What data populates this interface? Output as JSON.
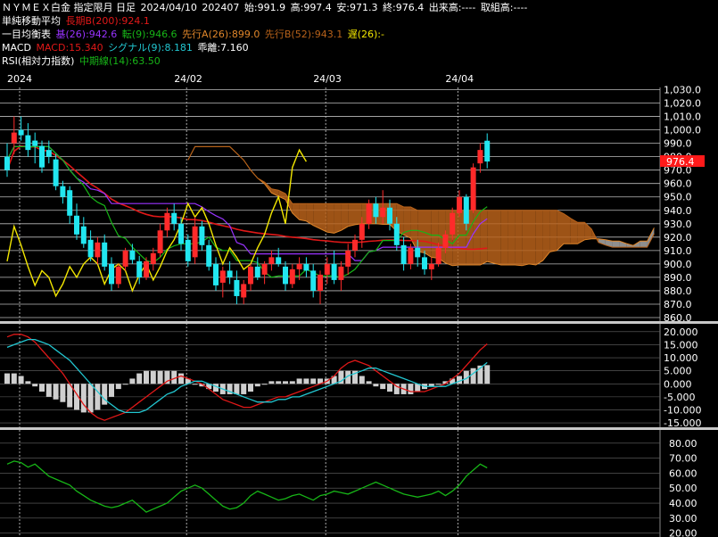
{
  "header": {
    "line1": {
      "title": "ＮＹＭＥＸ白金 指定限月 日足",
      "date": "2024/04/10",
      "contract": "202407",
      "open": "始:991.9",
      "high": "高:997.4",
      "low": "安:971.3",
      "close": "終:976.4",
      "volume": "出来高:----",
      "oi": "取組高:----"
    },
    "line2": {
      "label": "単純移動平均",
      "ma": "長期B(200):924.1"
    },
    "line3": {
      "label": "一目均衡表",
      "kijun": "基(26):942.6",
      "tenkan": "転(9):946.6",
      "spanA": "先行A(26):899.0",
      "spanB": "先行B(52):943.1",
      "chikou": "遅(26):-"
    },
    "line4": {
      "label": "MACD",
      "macd": "MACD:15.340",
      "signal": "シグナル(9):8.181",
      "hist": "乖離:7.160"
    },
    "line5": {
      "label": "RSI(相対力指数)",
      "rsi": "中期線(14):63.50"
    }
  },
  "colors": {
    "up": "#ff2a2a",
    "down": "#22e6f0",
    "ma200": "#e01818",
    "kijun": "#9933ff",
    "tenkan": "#17b517",
    "chikou": "#f2e600",
    "cloud_bull": "#b8621a",
    "cloud_bear": "#a8a8a8",
    "price_tag": "#ff1a1a"
  },
  "chart_data": [
    {
      "type": "candlestick",
      "x_labels": [
        "2024",
        "24/02",
        "24/03",
        "24/04"
      ],
      "y_ticks": [
        "1,030.0",
        "1,020.0",
        "1,010.0",
        "1,000.0",
        "990.0",
        "980.0",
        "970.0",
        "960.0",
        "950.0",
        "940.0",
        "930.0",
        "920.0",
        "910.0",
        "900.0",
        "890.0",
        "880.0",
        "870.0",
        "860.0"
      ],
      "ylim": [
        858,
        1031
      ],
      "last_price_label": "976.4",
      "candles": [
        [
          980,
          990,
          965,
          970
        ],
        [
          990,
          1010,
          982,
          998
        ],
        [
          1000,
          1010,
          992,
          996
        ],
        [
          996,
          1005,
          980,
          985
        ],
        [
          992,
          998,
          975,
          988
        ],
        [
          988,
          992,
          968,
          972
        ],
        [
          985,
          992,
          975,
          980
        ],
        [
          978,
          982,
          955,
          958
        ],
        [
          958,
          962,
          945,
          950
        ],
        [
          955,
          958,
          930,
          936
        ],
        [
          936,
          945,
          918,
          922
        ],
        [
          928,
          935,
          912,
          915
        ],
        [
          918,
          925,
          902,
          905
        ],
        [
          905,
          920,
          900,
          916
        ],
        [
          916,
          922,
          895,
          898
        ],
        [
          900,
          905,
          880,
          885
        ],
        [
          885,
          900,
          882,
          898
        ],
        [
          898,
          912,
          895,
          910
        ],
        [
          910,
          915,
          900,
          903
        ],
        [
          902,
          906,
          885,
          890
        ],
        [
          890,
          905,
          888,
          902
        ],
        [
          900,
          912,
          895,
          908
        ],
        [
          908,
          930,
          905,
          925
        ],
        [
          925,
          942,
          920,
          938
        ],
        [
          938,
          945,
          925,
          930
        ],
        [
          930,
          935,
          910,
          915
        ],
        [
          918,
          922,
          898,
          902
        ],
        [
          905,
          935,
          900,
          928
        ],
        [
          928,
          932,
          910,
          914
        ],
        [
          914,
          918,
          895,
          898
        ],
        [
          900,
          905,
          880,
          884
        ],
        [
          886,
          898,
          875,
          895
        ],
        [
          895,
          902,
          885,
          890
        ],
        [
          888,
          895,
          870,
          876
        ],
        [
          875,
          888,
          870,
          885
        ],
        [
          885,
          900,
          880,
          898
        ],
        [
          898,
          905,
          888,
          890
        ],
        [
          892,
          902,
          885,
          900
        ],
        [
          900,
          910,
          895,
          905
        ],
        [
          905,
          912,
          898,
          900
        ],
        [
          898,
          902,
          880,
          885
        ],
        [
          885,
          900,
          882,
          896
        ],
        [
          896,
          905,
          888,
          900
        ],
        [
          900,
          905,
          890,
          895
        ],
        [
          895,
          900,
          875,
          880
        ],
        [
          880,
          895,
          870,
          892
        ],
        [
          892,
          905,
          885,
          900
        ],
        [
          900,
          910,
          885,
          888
        ],
        [
          888,
          902,
          880,
          898
        ],
        [
          898,
          915,
          892,
          910
        ],
        [
          910,
          922,
          905,
          918
        ],
        [
          918,
          935,
          912,
          930
        ],
        [
          930,
          948,
          926,
          945
        ],
        [
          945,
          950,
          930,
          935
        ],
        [
          935,
          955,
          930,
          942
        ],
        [
          942,
          948,
          925,
          930
        ],
        [
          930,
          935,
          910,
          914
        ],
        [
          914,
          920,
          895,
          900
        ],
        [
          900,
          915,
          896,
          912
        ],
        [
          912,
          918,
          898,
          905
        ],
        [
          905,
          910,
          892,
          896
        ],
        [
          896,
          905,
          888,
          900
        ],
        [
          900,
          916,
          898,
          912
        ],
        [
          912,
          925,
          908,
          922
        ],
        [
          922,
          942,
          918,
          938
        ],
        [
          938,
          955,
          935,
          950
        ],
        [
          950,
          952,
          925,
          930
        ],
        [
          940,
          975,
          938,
          972
        ],
        [
          975,
          990,
          968,
          985
        ],
        [
          991.9,
          997.4,
          971.3,
          976.4
        ]
      ]
    },
    {
      "type": "line+histogram",
      "name": "MACD",
      "y_ticks": [
        "20.000",
        "15.000",
        "10.000",
        "5.000",
        "0.000",
        "-5.000",
        "-10.000",
        "-15.000"
      ],
      "ylim": [
        -16,
        22
      ],
      "macd": [
        18,
        19,
        19,
        18,
        16,
        13,
        10,
        7,
        4,
        0,
        -4,
        -8,
        -11,
        -13,
        -14,
        -13,
        -12,
        -11,
        -9,
        -7,
        -5,
        -3,
        -1,
        1,
        2,
        3,
        2,
        1,
        0,
        -2,
        -4,
        -6,
        -7,
        -8,
        -9,
        -9,
        -8,
        -7,
        -6,
        -5,
        -5,
        -4,
        -3,
        -2,
        -1,
        0,
        1,
        3,
        6,
        8,
        9,
        8,
        7,
        5,
        3,
        1,
        -1,
        -2,
        -3,
        -3,
        -3,
        -2,
        -1,
        0,
        2,
        4,
        7,
        10,
        13,
        15.34
      ],
      "signal": [
        14,
        15,
        16,
        17,
        17,
        16,
        15,
        13,
        11,
        9,
        6,
        3,
        0,
        -3,
        -6,
        -8,
        -10,
        -11,
        -11,
        -11,
        -10,
        -8,
        -6,
        -4,
        -3,
        -1,
        0,
        1,
        1,
        0,
        -1,
        -2,
        -3,
        -4,
        -5,
        -6,
        -7,
        -7,
        -7,
        -6,
        -6,
        -5,
        -5,
        -4,
        -3,
        -2,
        -1,
        0,
        1,
        3,
        4,
        5,
        6,
        6,
        5,
        4,
        3,
        2,
        1,
        0,
        -1,
        -1,
        -1,
        -1,
        0,
        1,
        2,
        4,
        6,
        8.181
      ]
    },
    {
      "type": "line",
      "name": "RSI",
      "y_ticks": [
        "80.00",
        "70.00",
        "60.00",
        "50.00",
        "40.00",
        "30.00",
        "20.00"
      ],
      "ylim": [
        18,
        87
      ],
      "values": [
        66,
        68,
        67,
        64,
        66,
        62,
        58,
        56,
        54,
        52,
        48,
        45,
        42,
        40,
        38,
        37,
        38,
        40,
        42,
        38,
        34,
        36,
        38,
        40,
        44,
        48,
        50,
        52,
        50,
        46,
        42,
        38,
        36,
        37,
        40,
        45,
        48,
        46,
        44,
        42,
        43,
        45,
        46,
        44,
        42,
        45,
        46,
        48,
        47,
        46,
        48,
        50,
        52,
        54,
        52,
        50,
        48,
        46,
        45,
        44,
        45,
        46,
        48,
        45,
        48,
        52,
        58,
        62,
        66,
        63.5
      ]
    }
  ]
}
